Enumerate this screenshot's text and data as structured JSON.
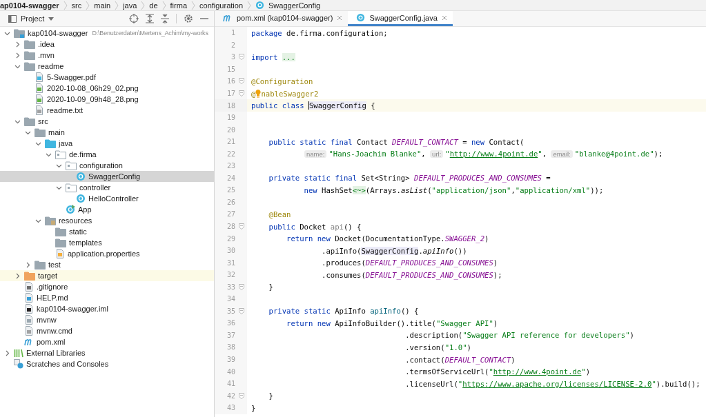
{
  "breadcrumbs": [
    {
      "label": "ap0104-swagger",
      "kind": "module",
      "bold": true
    },
    {
      "label": "src",
      "kind": "folder",
      "bold": false
    },
    {
      "label": "main",
      "kind": "folder",
      "bold": false
    },
    {
      "label": "java",
      "kind": "folder",
      "bold": false
    },
    {
      "label": "de",
      "kind": "folder",
      "bold": false
    },
    {
      "label": "firma",
      "kind": "folder",
      "bold": false
    },
    {
      "label": "configuration",
      "kind": "folder",
      "bold": false
    },
    {
      "label": "SwaggerConfig",
      "kind": "class",
      "bold": false
    }
  ],
  "project_panel": {
    "title": "Project"
  },
  "tree": [
    {
      "label": "kap0104-swagger",
      "path": "D:\\Benutzerdaten\\Mertens_Achim\\my-works",
      "kind": "module",
      "expanded": true,
      "selected": false,
      "highlighted": false,
      "children": [
        {
          "label": ".idea",
          "kind": "folder",
          "expanded": false,
          "selected": false,
          "highlighted": false
        },
        {
          "label": ".mvn",
          "kind": "folder",
          "expanded": false,
          "selected": false,
          "highlighted": false
        },
        {
          "label": "readme",
          "kind": "folder",
          "expanded": true,
          "selected": false,
          "highlighted": false,
          "children": [
            {
              "label": "5-Swagger.pdf",
              "kind": "pdf",
              "selected": false,
              "highlighted": false
            },
            {
              "label": "2020-10-08_06h29_02.png",
              "kind": "image",
              "selected": false,
              "highlighted": false
            },
            {
              "label": "2020-10-09_09h48_28.png",
              "kind": "image",
              "selected": false,
              "highlighted": false
            },
            {
              "label": "readme.txt",
              "kind": "text",
              "selected": false,
              "highlighted": false
            }
          ]
        },
        {
          "label": "src",
          "kind": "folder",
          "expanded": true,
          "selected": false,
          "highlighted": false,
          "children": [
            {
              "label": "main",
              "kind": "folder",
              "expanded": true,
              "selected": false,
              "highlighted": false,
              "children": [
                {
                  "label": "java",
                  "kind": "source",
                  "expanded": true,
                  "selected": false,
                  "highlighted": false,
                  "children": [
                    {
                      "label": "de.firma",
                      "kind": "package",
                      "expanded": true,
                      "selected": false,
                      "highlighted": false,
                      "children": [
                        {
                          "label": "configuration",
                          "kind": "package",
                          "expanded": true,
                          "selected": false,
                          "highlighted": false,
                          "children": [
                            {
                              "label": "SwaggerConfig",
                              "kind": "class",
                              "selected": true,
                              "highlighted": false
                            }
                          ]
                        },
                        {
                          "label": "controller",
                          "kind": "package",
                          "expanded": true,
                          "selected": false,
                          "highlighted": false,
                          "children": [
                            {
                              "label": "HelloController",
                              "kind": "class",
                              "selected": false,
                              "highlighted": false
                            }
                          ]
                        },
                        {
                          "label": "App",
                          "kind": "app",
                          "selected": false,
                          "highlighted": false
                        }
                      ]
                    }
                  ]
                },
                {
                  "label": "resources",
                  "kind": "resources",
                  "expanded": true,
                  "selected": false,
                  "highlighted": false,
                  "children": [
                    {
                      "label": "static",
                      "kind": "folder",
                      "selected": false,
                      "highlighted": false
                    },
                    {
                      "label": "templates",
                      "kind": "folder",
                      "selected": false,
                      "highlighted": false
                    },
                    {
                      "label": "application.properties",
                      "kind": "properties",
                      "selected": false,
                      "highlighted": false
                    }
                  ]
                }
              ]
            },
            {
              "label": "test",
              "kind": "folder",
              "expanded": false,
              "selected": false,
              "highlighted": false
            }
          ]
        },
        {
          "label": "target",
          "kind": "excluded",
          "expanded": false,
          "selected": false,
          "highlighted": true
        },
        {
          "label": ".gitignore",
          "kind": "ignore",
          "selected": false,
          "highlighted": false
        },
        {
          "label": "HELP.md",
          "kind": "markdown",
          "selected": false,
          "highlighted": false
        },
        {
          "label": "kap0104-swagger.iml",
          "kind": "iml",
          "selected": false,
          "highlighted": false
        },
        {
          "label": "mvnw",
          "kind": "script",
          "selected": false,
          "highlighted": false
        },
        {
          "label": "mvnw.cmd",
          "kind": "text",
          "selected": false,
          "highlighted": false
        },
        {
          "label": "pom.xml",
          "kind": "maven",
          "selected": false,
          "highlighted": false
        }
      ]
    },
    {
      "label": "External Libraries",
      "kind": "libraries",
      "expanded": false,
      "selected": false,
      "highlighted": false
    },
    {
      "label": "Scratches and Consoles",
      "kind": "scratches",
      "selected": false,
      "highlighted": false
    }
  ],
  "tabs": [
    {
      "label": "pom.xml (kap0104-swagger)",
      "kind": "maven",
      "selected": false
    },
    {
      "label": "SwaggerConfig.java",
      "kind": "class",
      "selected": true
    }
  ],
  "code": [
    {
      "number": "1",
      "fold": false,
      "current": false,
      "tokens": [
        {
          "kind": "kw",
          "text": "package "
        },
        {
          "kind": "plain",
          "text": "de.firma.configuration;"
        }
      ]
    },
    {
      "number": "2",
      "fold": false,
      "current": false
    },
    {
      "number": "3",
      "fold": true,
      "current": false,
      "tokens": [
        {
          "kind": "kw",
          "text": "import "
        },
        {
          "kind": "fold",
          "text": "..."
        }
      ]
    },
    {
      "number": "15",
      "fold": false,
      "current": false
    },
    {
      "number": "16",
      "fold": true,
      "current": false,
      "tokens": [
        {
          "kind": "ann",
          "text": "@Configuration"
        }
      ]
    },
    {
      "number": "17",
      "fold": true,
      "current": false,
      "tokens": [
        {
          "kind": "ann",
          "text": "@"
        },
        {
          "kind": "bulb"
        },
        {
          "kind": "ann",
          "text": "nableSwagger2"
        }
      ]
    },
    {
      "number": "18",
      "fold": false,
      "current": true,
      "tokens": [
        {
          "kind": "kw",
          "text": "public class "
        },
        {
          "kind": "ref",
          "text": "SwaggerConfig"
        },
        {
          "kind": "plain",
          "text": " {"
        }
      ]
    },
    {
      "number": "19",
      "fold": false,
      "current": false
    },
    {
      "number": "20",
      "fold": false,
      "current": false
    },
    {
      "number": "21",
      "fold": false,
      "current": false,
      "tokens": [
        {
          "kind": "kw",
          "text": "    public static final "
        },
        {
          "kind": "plain",
          "text": "Contact "
        },
        {
          "kind": "const",
          "text": "DEFAULT_CONTACT"
        },
        {
          "kind": "plain",
          "text": " = "
        },
        {
          "kind": "kw",
          "text": "new "
        },
        {
          "kind": "plain",
          "text": "Contact("
        }
      ]
    },
    {
      "number": "22",
      "fold": false,
      "current": false,
      "tokens": [
        {
          "kind": "hint",
          "text": "name:"
        },
        {
          "kind": "str",
          "text": "\"Hans-Joachim Blanke\""
        },
        {
          "kind": "plain",
          "text": ", "
        },
        {
          "kind": "hint",
          "text": "url:"
        },
        {
          "kind": "str",
          "text": "\""
        },
        {
          "kind": "link",
          "text": "http://www.4point.de"
        },
        {
          "kind": "str",
          "text": "\""
        },
        {
          "kind": "plain",
          "text": ", "
        },
        {
          "kind": "hint",
          "text": "email:"
        },
        {
          "kind": "str",
          "text": "\"blanke@4point.de\""
        },
        {
          "kind": "plain",
          "text": ");"
        }
      ]
    },
    {
      "number": "23",
      "fold": false,
      "current": false
    },
    {
      "number": "24",
      "fold": false,
      "current": false,
      "tokens": [
        {
          "kind": "kw",
          "text": "    private static final "
        },
        {
          "kind": "plain",
          "text": "Set<String> "
        },
        {
          "kind": "const",
          "text": "DEFAULT_PRODUCES_AND_CONSUMES"
        },
        {
          "kind": "plain",
          "text": " ="
        }
      ]
    },
    {
      "number": "25",
      "fold": false,
      "current": false,
      "tokens": [
        {
          "kind": "kw",
          "text": "            new "
        },
        {
          "kind": "plain",
          "text": "HashSet"
        },
        {
          "kind": "fold",
          "text": "<~>"
        },
        {
          "kind": "plain",
          "text": "(Arrays."
        },
        {
          "kind": "italic",
          "text": "asList"
        },
        {
          "kind": "plain",
          "text": "("
        },
        {
          "kind": "str",
          "text": "\"application/json\""
        },
        {
          "kind": "plain",
          "text": ","
        },
        {
          "kind": "str",
          "text": "\"application/xml\""
        },
        {
          "kind": "plain",
          "text": "));"
        }
      ]
    },
    {
      "number": "26",
      "fold": false,
      "current": false
    },
    {
      "number": "27",
      "fold": false,
      "current": false,
      "tokens": [
        {
          "kind": "ann",
          "text": "    @Bean"
        }
      ]
    },
    {
      "number": "28",
      "fold": true,
      "current": false,
      "tokens": [
        {
          "kind": "kw",
          "text": "    public "
        },
        {
          "kind": "plain",
          "text": "Docket "
        },
        {
          "kind": "unused",
          "text": "api"
        },
        {
          "kind": "plain",
          "text": "() {"
        }
      ]
    },
    {
      "number": "29",
      "fold": false,
      "current": false,
      "tokens": [
        {
          "kind": "kw",
          "text": "        return new "
        },
        {
          "kind": "plain",
          "text": "Docket(DocumentationType."
        },
        {
          "kind": "const",
          "text": "SWAGGER_2"
        },
        {
          "kind": "plain",
          "text": ")"
        }
      ]
    },
    {
      "number": "30",
      "fold": false,
      "current": false,
      "tokens": [
        {
          "kind": "plain",
          "text": "                .apiInfo("
        },
        {
          "kind": "ref",
          "text": "SwaggerConfig"
        },
        {
          "kind": "plain",
          "text": "."
        },
        {
          "kind": "italic",
          "text": "apiInfo"
        },
        {
          "kind": "plain",
          "text": "())"
        }
      ]
    },
    {
      "number": "31",
      "fold": false,
      "current": false,
      "tokens": [
        {
          "kind": "plain",
          "text": "                .produces("
        },
        {
          "kind": "const",
          "text": "DEFAULT_PRODUCES_AND_CONSUMES"
        },
        {
          "kind": "plain",
          "text": ")"
        }
      ]
    },
    {
      "number": "32",
      "fold": false,
      "current": false,
      "tokens": [
        {
          "kind": "plain",
          "text": "                .consumes("
        },
        {
          "kind": "const",
          "text": "DEFAULT_PRODUCES_AND_CONSUMES"
        },
        {
          "kind": "plain",
          "text": ");"
        }
      ]
    },
    {
      "number": "33",
      "fold": true,
      "current": false,
      "tokens": [
        {
          "kind": "plain",
          "text": "    }"
        }
      ]
    },
    {
      "number": "34",
      "fold": false,
      "current": false
    },
    {
      "number": "35",
      "fold": true,
      "current": false,
      "tokens": [
        {
          "kind": "kw",
          "text": "    private static "
        },
        {
          "kind": "plain",
          "text": "ApiInfo "
        },
        {
          "kind": "method",
          "text": "apiInfo"
        },
        {
          "kind": "plain",
          "text": "() {"
        }
      ]
    },
    {
      "number": "36",
      "fold": false,
      "current": false,
      "tokens": [
        {
          "kind": "kw",
          "text": "        return new "
        },
        {
          "kind": "plain",
          "text": "ApiInfoBuilder().title("
        },
        {
          "kind": "str",
          "text": "\"Swagger API\""
        },
        {
          "kind": "plain",
          "text": ")"
        }
      ]
    },
    {
      "number": "37",
      "fold": false,
      "current": false,
      "tokens": [
        {
          "kind": "plain",
          "text": "                                   .description("
        },
        {
          "kind": "str",
          "text": "\"Swagger API reference for developers\""
        },
        {
          "kind": "plain",
          "text": ")"
        }
      ]
    },
    {
      "number": "38",
      "fold": false,
      "current": false,
      "tokens": [
        {
          "kind": "plain",
          "text": "                                   .version("
        },
        {
          "kind": "str",
          "text": "\"1.0\""
        },
        {
          "kind": "plain",
          "text": ")"
        }
      ]
    },
    {
      "number": "39",
      "fold": false,
      "current": false,
      "tokens": [
        {
          "kind": "plain",
          "text": "                                   .contact("
        },
        {
          "kind": "const",
          "text": "DEFAULT_CONTACT"
        },
        {
          "kind": "plain",
          "text": ")"
        }
      ]
    },
    {
      "number": "40",
      "fold": false,
      "current": false,
      "tokens": [
        {
          "kind": "plain",
          "text": "                                   .termsOfServiceUrl("
        },
        {
          "kind": "str",
          "text": "\""
        },
        {
          "kind": "link",
          "text": "http://www.4point.de"
        },
        {
          "kind": "str",
          "text": "\""
        },
        {
          "kind": "plain",
          "text": ")"
        }
      ]
    },
    {
      "number": "41",
      "fold": false,
      "current": false,
      "tokens": [
        {
          "kind": "plain",
          "text": "                                   .licenseUrl("
        },
        {
          "kind": "str",
          "text": "\""
        },
        {
          "kind": "link",
          "text": "https://www.apache.org/licenses/LICENSE-2.0"
        },
        {
          "kind": "str",
          "text": "\""
        },
        {
          "kind": "plain",
          "text": ").build();"
        }
      ]
    },
    {
      "number": "42",
      "fold": true,
      "current": false,
      "tokens": [
        {
          "kind": "plain",
          "text": "    }"
        }
      ]
    },
    {
      "number": "43",
      "fold": false,
      "current": false,
      "tokens": [
        {
          "kind": "plain",
          "text": "}"
        }
      ]
    }
  ]
}
